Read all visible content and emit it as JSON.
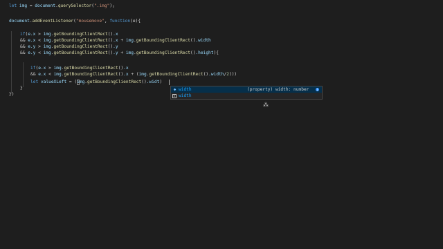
{
  "code": {
    "line1": {
      "kw_let": "let",
      "var_img": " img",
      "eq": " = ",
      "obj_document": "document",
      "dot1": ".",
      "fn_query": "querySelector",
      "open": "(",
      "str": "\".img\"",
      "close": ");"
    },
    "line3": {
      "obj_document": "document",
      "dot": ".",
      "fn_add": "addEventListener",
      "open": "(",
      "str": "\"mousemove\"",
      "comma": ", ",
      "kw_function": "function",
      "params": "(e){"
    },
    "line5": {
      "kw_if": "if",
      "open": "(",
      "v_e": "e",
      "dot_x": ".x",
      "gt": " > ",
      "v_img": "img",
      "dot": ".",
      "fn": "getBoundingClientRect",
      "call": "()",
      "prop": ".x"
    },
    "line6": {
      "and": "&& ",
      "v_e": "e",
      "dot_x": ".x",
      "lt": " < ",
      "v_img": "img",
      "dot": ".",
      "fn": "getBoundingClientRect",
      "call": "()",
      "prop": ".x",
      "plus": " + ",
      "v_img2": "img",
      "dot2": ".",
      "fn2": "getBoundingClientRect",
      "call2": "()",
      "prop2": ".width"
    },
    "line7": {
      "and": "&& ",
      "v_e": "e",
      "dot_y": ".y",
      "gt": " > ",
      "v_img": "img",
      "dot": ".",
      "fn": "getBoundingClientRect",
      "call": "()",
      "prop": ".y"
    },
    "line8": {
      "and": "&& ",
      "v_e": "e",
      "dot_y": ".y",
      "lt": " < ",
      "v_img": "img",
      "dot": ".",
      "fn": "getBoundingClientRect",
      "call": "()",
      "prop": ".y",
      "plus": " + ",
      "v_img2": "img",
      "dot2": ".",
      "fn2": "getBoundingClientRect",
      "call2": "()",
      "prop2": ".height",
      "close": "){"
    },
    "line10": {
      "kw_if": "if",
      "open": "(",
      "v_e": "e",
      "dot_x": ".x",
      "gt": " > ",
      "v_img": "img",
      "dot": ".",
      "fn": "getBoundingClientRect",
      "call": "()",
      "prop": ".x"
    },
    "line11": {
      "and": "&& ",
      "v_e": "e",
      "dot_x": ".x",
      "lt": " < ",
      "v_img": "img",
      "dot": ".",
      "fn": "getBoundingClientRect",
      "call": "()",
      "prop": ".x",
      "plus": " + ",
      "paren": "(",
      "v_img2": "img",
      "dot2": ".",
      "fn2": "getBoundingClientRect",
      "call2": "()",
      "prop2": ".width",
      "div": "/",
      "num": "2",
      "close": ")))"
    },
    "line12": {
      "kw_let": "let",
      "var": " valueXLeft",
      "eq": " = ",
      "paren": "(",
      "v_img": "img",
      "dot": ".",
      "fn": "getBoundingClientRect",
      "call": "()",
      "prop": ".widt",
      "close": ")"
    },
    "line13": {
      "brace": "}"
    },
    "line14": {
      "brace": "})"
    }
  },
  "suggest_widget": {
    "items": [
      {
        "icon": "property-icon",
        "match": "width",
        "detail": "(property) width: number",
        "info": "i"
      },
      {
        "icon": "text-icon",
        "match": "width"
      }
    ]
  },
  "colors": {
    "background": "#1e1e1e",
    "keyword": "#569cd6",
    "variable": "#9cdcfe",
    "function": "#dcdcaa",
    "string": "#ce9178",
    "number": "#b5cea8",
    "match_highlight": "#18a3ff",
    "selection": "#062f4a"
  }
}
